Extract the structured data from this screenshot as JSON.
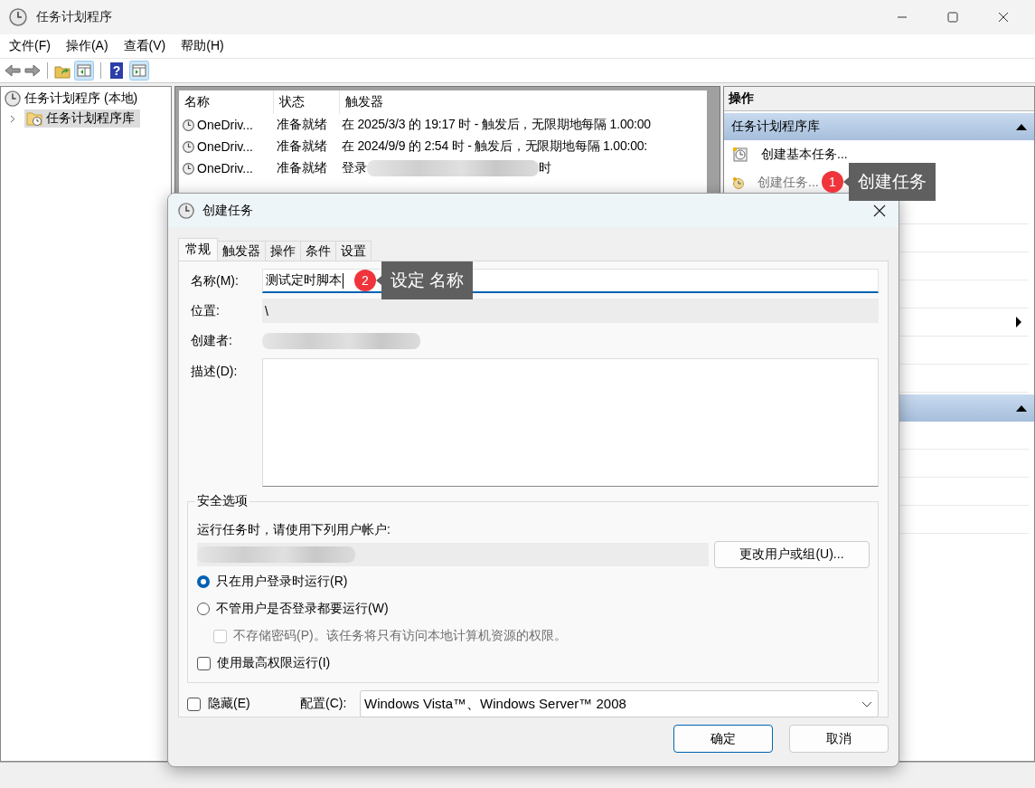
{
  "window": {
    "title": "任务计划程序"
  },
  "menu": [
    "文件(F)",
    "操作(A)",
    "查看(V)",
    "帮助(H)"
  ],
  "toolbar": [
    {
      "kind": "back"
    },
    {
      "kind": "forward"
    },
    {
      "kind": "separator"
    },
    {
      "kind": "up"
    },
    {
      "kind": "pane"
    },
    {
      "kind": "separator"
    },
    {
      "kind": "help",
      "glyph": "?"
    },
    {
      "kind": "pane2"
    }
  ],
  "tree": [
    {
      "label": "任务计划程序 (本地)",
      "children": [
        {
          "label": "任务计划程序库",
          "selected": true,
          "expanded": false
        }
      ]
    }
  ],
  "task_list": {
    "columns": [
      "名称",
      "状态",
      "触发器"
    ],
    "rows": [
      {
        "name": "OneDriv...",
        "status": "准备就绪",
        "trigger": "在 2025/3/3 的 19:17 时 - 触发后，无限期地每隔 1.00:00"
      },
      {
        "name": "OneDriv...",
        "status": "准备就绪",
        "trigger": "在 2024/9/9 的 2:54 时 - 触发后，无限期地每隔 1.00:00:"
      },
      {
        "name": "OneDriv...",
        "status": "准备就绪",
        "trigger": "登录",
        "redacted": true,
        "trigger_end": "时"
      }
    ]
  },
  "actions": {
    "title": "操作",
    "sections": [
      {
        "title": "任务计划程序库",
        "expanded": true,
        "items": [
          {
            "label": "创建基本任务...",
            "kind": "basic",
            "disabled": false
          },
          {
            "label": "创建任务...",
            "kind": "task",
            "disabled": true
          },
          {
            "submenu": false
          },
          {
            "submenu": false
          },
          {
            "submenu": false
          },
          {
            "submenu": false
          },
          {
            "submenu": true
          },
          {
            "submenu": false
          },
          {
            "submenu": false
          }
        ]
      },
      {
        "expanded": true,
        "items": [
          {
            "submenu": false
          },
          {
            "submenu": false
          },
          {
            "submenu": false
          },
          {
            "submenu": false
          }
        ]
      }
    ]
  },
  "dialog": {
    "title": "创建任务",
    "tabs": [
      {
        "label": "常规",
        "selected": true
      },
      {
        "label": "触发器",
        "selected": false
      },
      {
        "label": "操作",
        "selected": false
      },
      {
        "label": "条件",
        "selected": false
      },
      {
        "label": "设置",
        "selected": false
      }
    ],
    "name": {
      "label": "名称(M):",
      "value": "测试定时脚本"
    },
    "location": {
      "label": "位置:",
      "value": "\\"
    },
    "author": {
      "label": "创建者:",
      "redacted": true
    },
    "description": {
      "label": "描述(D):"
    },
    "security": {
      "title": "安全选项",
      "prompt": "运行任务时，请使用下列用户帐户:",
      "account_redacted": true,
      "change_button": "更改用户或组(U)...",
      "options": [
        {
          "kind": "radio",
          "label": "只在用户登录时运行(R)",
          "selected": true
        },
        {
          "kind": "radio",
          "label": "不管用户是否登录都要运行(W)",
          "selected": false,
          "children": [
            {
              "kind": "checkbox",
              "label": "不存储密码(P)。该任务将只有访问本地计算机资源的权限。",
              "checked": false,
              "disabled": true
            }
          ]
        },
        {
          "kind": "checkbox",
          "label": "使用最高权限运行(I)",
          "checked": false,
          "disabled": false
        }
      ]
    },
    "hidden": {
      "label": "隐藏(E)",
      "checked": false
    },
    "config": {
      "label": "配置(C):",
      "value": "Windows Vista™、Windows Server™ 2008"
    },
    "buttons": [
      {
        "label": "确定",
        "default": true
      },
      {
        "label": "取消",
        "default": false
      }
    ]
  },
  "annotations": [
    {
      "kind": "create-task",
      "number": "1",
      "text": "创建任务"
    },
    {
      "kind": "name-field",
      "number": "2",
      "text": "设定 名称"
    }
  ]
}
